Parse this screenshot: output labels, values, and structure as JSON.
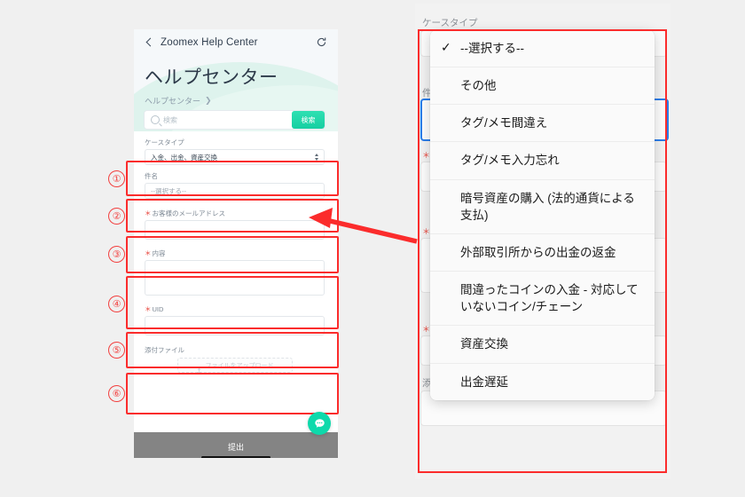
{
  "phone": {
    "topbar": {
      "back_icon": "chevron-left-icon",
      "title": "Zoomex Help Center",
      "refresh_icon": "refresh-icon"
    },
    "hero": {
      "title": "ヘルプセンター",
      "breadcrumb": "ヘルプセンター",
      "breadcrumb_separator": "❯"
    },
    "search": {
      "icon": "search-icon",
      "placeholder": "検索",
      "button_label": "検索"
    },
    "form": {
      "fields": [
        {
          "number": "①",
          "label": "ケースタイプ",
          "value": "入金、出金、資産交換",
          "type": "select",
          "required": false
        },
        {
          "number": "②",
          "label": "件名",
          "value": "--選択する--",
          "type": "select",
          "required": false
        },
        {
          "number": "③",
          "label": "お客様のメールアドレス",
          "value": "",
          "type": "text",
          "required": true
        },
        {
          "number": "④",
          "label": "内容",
          "value": "",
          "type": "textarea",
          "required": true
        },
        {
          "number": "⑤",
          "label": "UID",
          "value": "",
          "type": "text",
          "required": true
        },
        {
          "number": "⑥",
          "label": "添付ファイル",
          "value": "",
          "type": "file",
          "required": false,
          "upload_label": "ファイルをアップロード",
          "upload_icon": "upload-icon"
        }
      ],
      "submit_label": "提出"
    },
    "chat_icon": "chat-bubble-icon"
  },
  "right_panel": {
    "background": {
      "label_case_type": "ケースタイプ",
      "label_subject": "件",
      "label_attachment": "添"
    },
    "dropdown": {
      "check_icon": "check-icon",
      "options": [
        {
          "label": "--選択する--",
          "selected": true
        },
        {
          "label": "その他",
          "selected": false
        },
        {
          "label": "タグ/メモ間違え",
          "selected": false
        },
        {
          "label": "タグ/メモ入力忘れ",
          "selected": false
        },
        {
          "label": "暗号資産の購入 (法的通貨による支払)",
          "selected": false
        },
        {
          "label": "外部取引所からの出金の返金",
          "selected": false
        },
        {
          "label": "間違ったコインの入金 - 対応していないコイン/チェーン",
          "selected": false
        },
        {
          "label": "資産交換",
          "selected": false
        },
        {
          "label": "出金遅延",
          "selected": false
        }
      ]
    }
  },
  "colors": {
    "annotation_red": "#fb2c2c",
    "accent_teal": "#0ed9ab",
    "focus_blue": "#2b7de9",
    "required_red": "#e8453c",
    "submit_gray": "#848484"
  }
}
